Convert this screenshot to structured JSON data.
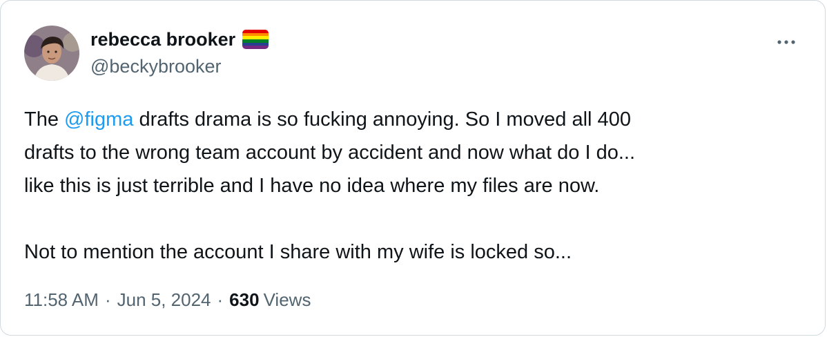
{
  "tweet": {
    "author": {
      "display_name": "rebecca brooker",
      "handle": "@beckybrooker",
      "name_emoji": "rainbow-flag"
    },
    "more_icon": "more-horizontal-icon",
    "body": {
      "line1_prefix": "The ",
      "mention": "@figma",
      "line1_suffix": " drafts drama is so fucking annoying. So I moved all 400",
      "line2": "drafts to the wrong team account by accident and now what do I do...",
      "line3": "like this is just terrible and I have no idea where my files are now.",
      "line4": "Not to mention the account I share with my wife is locked so..."
    },
    "meta": {
      "time": "11:58 AM",
      "date": "Jun 5, 2024",
      "separator": "·",
      "view_count": "630",
      "views_label": "Views"
    }
  },
  "colors": {
    "text_primary": "#0f1419",
    "text_secondary": "#536471",
    "link": "#1d9bf0",
    "border": "#cfd9de",
    "flag_stripes": [
      "#e40303",
      "#ff8c00",
      "#ffed00",
      "#008026",
      "#24408e",
      "#732982"
    ]
  }
}
